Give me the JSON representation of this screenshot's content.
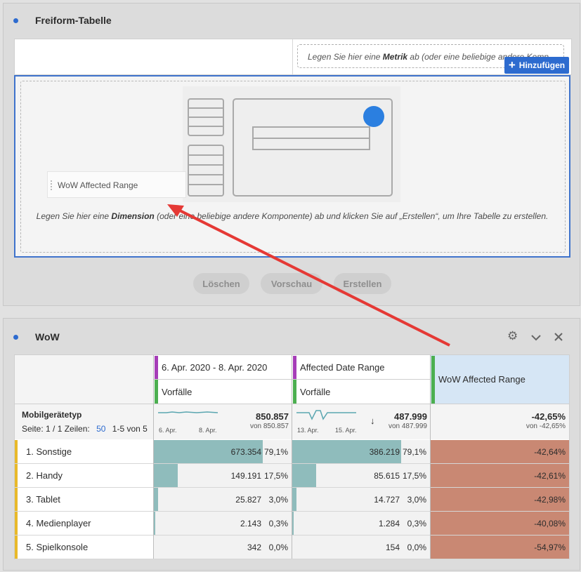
{
  "panel1": {
    "title": "Freiform-Tabelle",
    "metric_drop_hint_prefix": "Legen Sie hier eine ",
    "metric_drop_hint_bold": "Metrik",
    "metric_drop_hint_suffix": " ab (oder eine beliebige andere Komp",
    "add_button": "Hinzufügen",
    "dragged_item": "WoW Affected Range",
    "dimension_hint_prefix": "Legen Sie hier eine ",
    "dimension_hint_bold": "Dimension",
    "dimension_hint_suffix": " (oder eine beliebige andere Komponente) ab und klicken Sie auf „Erstellen“, um Ihre Tabelle zu erstellen.",
    "buttons": {
      "clear": "Löschen",
      "preview": "Vorschau",
      "build": "Erstellen"
    }
  },
  "panel2": {
    "title": "WoW",
    "col1": {
      "range": "6. Apr. 2020 - 8. Apr. 2020",
      "metric": "Vorfälle"
    },
    "col2": {
      "range": "Affected Date Range",
      "metric": "Vorfälle"
    },
    "col3": {
      "header": "WoW Affected Range"
    },
    "dimension": "Mobilgerätetyp",
    "page_label": "Seite: 1 / 1 Zeilen:",
    "rows_per_page": "50",
    "range_label": "1-5 von 5",
    "summary": {
      "c1_total": "850.857",
      "c1_of": "von 850.857",
      "c1_date_a": "6. Apr.",
      "c1_date_b": "8. Apr.",
      "c2_total": "487.999",
      "c2_of": "von 487.999",
      "c2_date_a": "13. Apr.",
      "c2_date_b": "15. Apr.",
      "c2_sort": "↓",
      "c3_total": "-42,65%",
      "c3_of": "von -42,65%"
    },
    "rows": [
      {
        "label": "1. Sonstige",
        "v1": "673.354",
        "p1": "79,1%",
        "v2": "386.219",
        "p2": "79,1%",
        "v3": "-42,64%",
        "f1": 0.791,
        "f2": 0.791
      },
      {
        "label": "2. Handy",
        "v1": "149.191",
        "p1": "17,5%",
        "v2": "85.615",
        "p2": "17,5%",
        "v3": "-42,61%",
        "f1": 0.175,
        "f2": 0.175
      },
      {
        "label": "3. Tablet",
        "v1": "25.827",
        "p1": "3,0%",
        "v2": "14.727",
        "p2": "3,0%",
        "v3": "-42,98%",
        "f1": 0.03,
        "f2": 0.03
      },
      {
        "label": "4. Medienplayer",
        "v1": "2.143",
        "p1": "0,3%",
        "v2": "1.284",
        "p2": "0,3%",
        "v3": "-40,08%",
        "f1": 0.003,
        "f2": 0.003
      },
      {
        "label": "5. Spielkonsole",
        "v1": "342",
        "p1": "0,0%",
        "v2": "154",
        "p2": "0,0%",
        "v3": "-54,97%",
        "f1": 0.0,
        "f2": 0.0
      }
    ]
  },
  "colors": {
    "accent": "#2d6bcf",
    "bar": "#8fbcbc",
    "negative": "#c98873",
    "row_marker": "#e8b92a",
    "purple": "#a63db8",
    "green": "#4caf50",
    "arrow": "#e53935"
  }
}
